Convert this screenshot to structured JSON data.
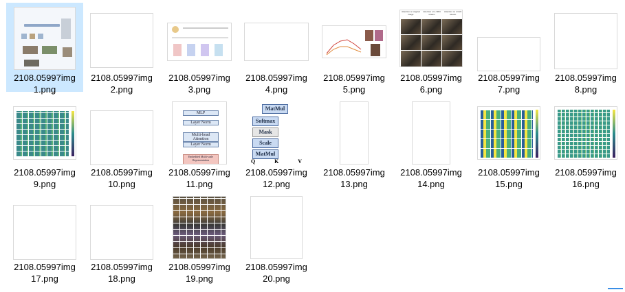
{
  "files": [
    {
      "line1": "2108.05997img",
      "line2": "1.png",
      "thumb": "diagram",
      "selected": true
    },
    {
      "line1": "2108.05997img",
      "line2": "2.png",
      "thumb": "blank"
    },
    {
      "line1": "2108.05997img",
      "line2": "3.png",
      "thumb": "paper-figure"
    },
    {
      "line1": "2108.05997img",
      "line2": "4.png",
      "thumb": "blank"
    },
    {
      "line1": "2108.05997img",
      "line2": "5.png",
      "thumb": "plot"
    },
    {
      "line1": "2108.05997img",
      "line2": "6.png",
      "thumb": "photo-grid",
      "header_texts": [
        "Attention on original image",
        "Attention on L=384 stream",
        "Attention on L=224 stream"
      ]
    },
    {
      "line1": "2108.05997img",
      "line2": "7.png",
      "thumb": "blank"
    },
    {
      "line1": "2108.05997img",
      "line2": "8.png",
      "thumb": "blank"
    },
    {
      "line1": "2108.05997img",
      "line2": "9.png",
      "thumb": "heatmap-grid"
    },
    {
      "line1": "2108.05997img",
      "line2": "10.png",
      "thumb": "blank"
    },
    {
      "line1": "2108.05997img",
      "line2": "11.png",
      "thumb": "transformer-block",
      "nodes": [
        "MLP",
        "Layer Norm",
        "Multi-head Attention",
        "Layer Norm",
        "Embedded Multi-scale Representation"
      ]
    },
    {
      "line1": "2108.05997img",
      "line2": "12.png",
      "thumb": "attention-block",
      "nodes": [
        "MatMul",
        "Softmax",
        "Mask",
        "Scale",
        "MatMul"
      ],
      "inputs": [
        "Q",
        "K",
        "V"
      ]
    },
    {
      "line1": "2108.05997img",
      "line2": "13.png",
      "thumb": "blank"
    },
    {
      "line1": "2108.05997img",
      "line2": "14.png",
      "thumb": "blank"
    },
    {
      "line1": "2108.05997img",
      "line2": "15.png",
      "thumb": "heatmap-grid"
    },
    {
      "line1": "2108.05997img",
      "line2": "16.png",
      "thumb": "heatmap-grid"
    },
    {
      "line1": "2108.05997img",
      "line2": "17.png",
      "thumb": "blank"
    },
    {
      "line1": "2108.05997img",
      "line2": "18.png",
      "thumb": "blank"
    },
    {
      "line1": "2108.05997img",
      "line2": "19.png",
      "thumb": "image-collage"
    },
    {
      "line1": "2108.05997img",
      "line2": "20.png",
      "thumb": "blank"
    }
  ],
  "colors": {
    "selection": "#cce8ff",
    "heat_low": "#3b1f5f",
    "heat_mid": "#2a8c8c",
    "heat_high": "#f5e642"
  }
}
